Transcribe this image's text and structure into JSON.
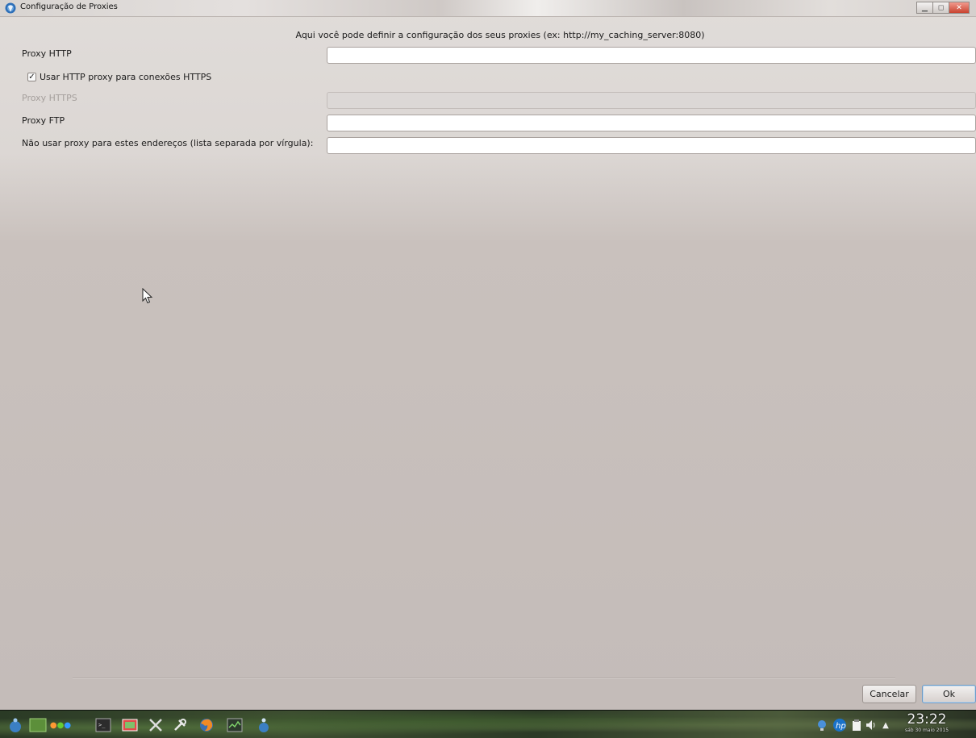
{
  "window": {
    "title": "Configuração de Proxies",
    "controls": {
      "minimize_icon": "minimize-icon",
      "maximize_icon": "maximize-icon",
      "close_icon": "close-icon"
    }
  },
  "form": {
    "intro": "Aqui você pode definir a configuração dos seus proxies (ex: http://my_caching_server:8080)",
    "http": {
      "label": "Proxy HTTP",
      "value": ""
    },
    "use_http_for_https": {
      "label": "Usar HTTP proxy para conexões HTTPS",
      "checked": true
    },
    "https": {
      "label": "Proxy HTTPS",
      "value": "",
      "disabled": true
    },
    "ftp": {
      "label": "Proxy FTP",
      "value": ""
    },
    "no_proxy": {
      "label": "Não usar proxy para estes endereços (lista separada por vírgula):",
      "value": ""
    }
  },
  "buttons": {
    "cancel": "Cancelar",
    "ok": "Ok"
  },
  "taskbar": {
    "launchers": [
      "app-menu-icon",
      "desktop-icon",
      "dots-icon",
      "terminal-icon",
      "image-viewer-icon",
      "tools-icon",
      "settings-icon",
      "firefox-icon",
      "system-monitor-icon",
      "mageia-icon"
    ],
    "tray": [
      "network-icon",
      "hp-icon",
      "clipboard-icon",
      "volume-icon",
      "expand-arrow-icon"
    ],
    "clock_time": "23:22",
    "clock_date": "sáb 30 maio 2015"
  },
  "colors": {
    "window_bg": "#d8d2cf",
    "close_button": "#c8432f",
    "ok_focus": "#6f9cc6"
  }
}
